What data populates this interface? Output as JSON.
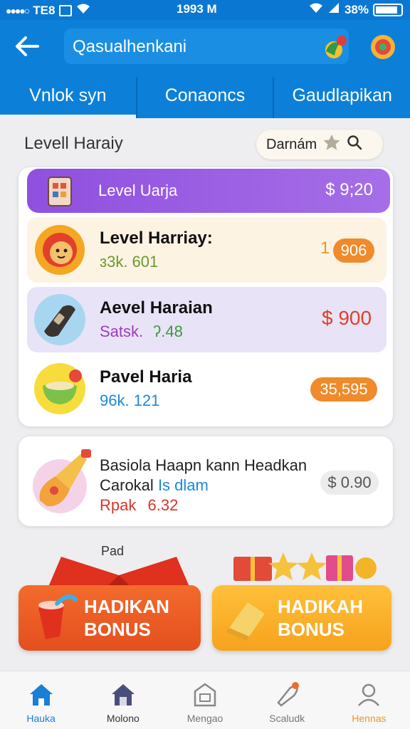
{
  "status_bar": {
    "carrier": "TE8",
    "time": "1993 M",
    "battery": "38%"
  },
  "header": {
    "back_icon": "arrow-left-icon",
    "search_text": "Qasualhenkani",
    "tabs": [
      {
        "label": "Vnlok syn",
        "active": true
      },
      {
        "label": "Conaoncs",
        "active": false
      },
      {
        "label": "Gaudlapikan",
        "active": false
      }
    ]
  },
  "section": {
    "title": "Levell Haraiy",
    "sort_label": "Darnám"
  },
  "banner": {
    "label": "Level Uarja",
    "value": "$ 9;20"
  },
  "items": [
    {
      "name": "Level Harriay:",
      "sub": "ɜ3k. 601",
      "pill": "906",
      "prefix": "1",
      "sub_color": "#6a9a2a"
    },
    {
      "name": "Aevel Haraian",
      "sub_a": "Satsk.",
      "sub_b": "ʔ.48",
      "value": "$ 900"
    },
    {
      "name": "Pavel Haria",
      "sub": "96k. 121",
      "pill": "35,595"
    }
  ],
  "promo": {
    "line1": "Basiola Haapn kann Headkan",
    "line2_a": "Carokal",
    "line2_b": "Is dlam",
    "line3_a": "Rpak",
    "line3_b": "6.32",
    "pill": "$ 0.90"
  },
  "bonus": {
    "small_label": "Pad",
    "left": {
      "line1": "HADIKAN",
      "line2": "BONUS"
    },
    "right": {
      "line1": "HADIKAH",
      "line2": "BONUS"
    }
  },
  "bottom_nav": [
    {
      "label": "Hauka",
      "icon": "home-icon",
      "color": "#1a7fd6"
    },
    {
      "label": "Molono",
      "icon": "house-icon",
      "color": "#333"
    },
    {
      "label": "Mengao",
      "icon": "store-icon",
      "color": "#777"
    },
    {
      "label": "Scaludk",
      "icon": "rocket-icon",
      "color": "#777"
    },
    {
      "label": "Hennas",
      "icon": "user-icon",
      "color": "#e8962a"
    }
  ]
}
